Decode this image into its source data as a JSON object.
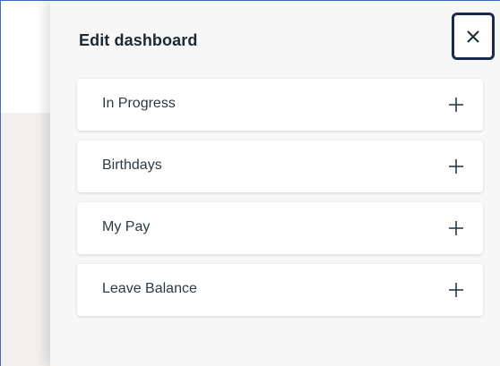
{
  "panel": {
    "title": "Edit dashboard",
    "close_icon": "close-icon"
  },
  "widgets": [
    {
      "label": "In Progress",
      "action_icon": "plus-icon"
    },
    {
      "label": "Birthdays",
      "action_icon": "plus-icon"
    },
    {
      "label": "My Pay",
      "action_icon": "plus-icon"
    },
    {
      "label": "Leave Balance",
      "action_icon": "plus-icon"
    }
  ],
  "colors": {
    "panel_background": "#f7f7f7",
    "card_background": "#ffffff",
    "text": "#2c3a44",
    "close_border": "#1b2a4a",
    "window_frame": "#3b6fbf"
  }
}
